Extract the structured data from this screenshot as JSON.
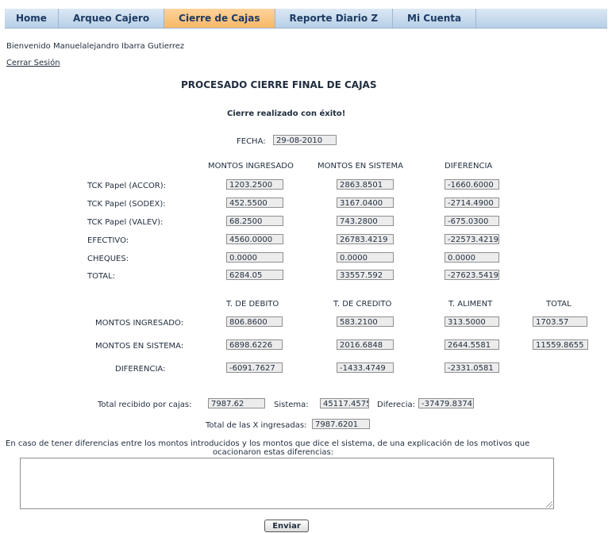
{
  "nav": {
    "tabs": [
      "Home",
      "Arqueo Cajero",
      "Cierre de Cajas",
      "Reporte Diario Z",
      "Mi Cuenta"
    ],
    "active": "Cierre de Cajas",
    "active_color": "#f7b867"
  },
  "welcome": "Bienvenido Manuelalejandro Ibarra Gutierrez",
  "logout": "Cerrar Sesión",
  "title": "PROCESADO CIERRE FINAL DE CAJAS",
  "success": "Cierre realizado con éxito!",
  "fecha": {
    "label": "FECHA:",
    "value": "29-08-2010"
  },
  "table1": {
    "headers": [
      "MONTOS INGRESADO",
      "MONTOS EN SISTEMA",
      "DIFERENCIA"
    ],
    "rows": [
      {
        "label": "TCK Papel (ACCOR):",
        "values": [
          "1203.2500",
          "2863.8501",
          "-1660.6000"
        ]
      },
      {
        "label": "TCK Papel (SODEX):",
        "values": [
          "452.5500",
          "3167.0400",
          "-2714.4900"
        ]
      },
      {
        "label": "TCK Papel (VALEV):",
        "values": [
          "68.2500",
          "743.2800",
          "-675.0300"
        ]
      },
      {
        "label": "EFECTIVO:",
        "values": [
          "4560.0000",
          "26783.4219",
          "-22573.4219"
        ]
      },
      {
        "label": "CHEQUES:",
        "values": [
          "0.0000",
          "0.0000",
          "0.0000"
        ]
      },
      {
        "label": "TOTAL:",
        "values": [
          "6284.05",
          "33557.592",
          "-27623.5419"
        ]
      }
    ]
  },
  "table2": {
    "headers": [
      "T. DE DEBITO",
      "T. DE CREDITO",
      "T. ALIMENT",
      "TOTAL"
    ],
    "rows": [
      {
        "label": "MONTOS INGRESADO:",
        "values": [
          "806.8600",
          "583.2100",
          "313.5000",
          "1703.57"
        ]
      },
      {
        "label": "MONTOS EN SISTEMA:",
        "values": [
          "6898.6226",
          "2016.6848",
          "2644.5581",
          "11559.8655"
        ]
      },
      {
        "label": "DIFERENCIA:",
        "values": [
          "-6091.7627",
          "-1433.4749",
          "-2331.0581"
        ]
      }
    ]
  },
  "summary": {
    "recibido_label": "Total recibido por cajas:",
    "recibido_value": "7987.62",
    "sistema_label": "Sistema:",
    "sistema_value": "45117.4575",
    "diferencia_label": "Diferecia:",
    "diferencia_value": "-37479.8374",
    "x_label": "Total de las X ingresadas:",
    "x_value": "7987.6201"
  },
  "explanation": {
    "line1": "En caso de tener diferencias entre los montos introducidos y los montos que dice el sistema, de una explicación de los motivos que",
    "line2": "ocacionaron estas diferencias:",
    "value": ""
  },
  "submit": "Enviar"
}
